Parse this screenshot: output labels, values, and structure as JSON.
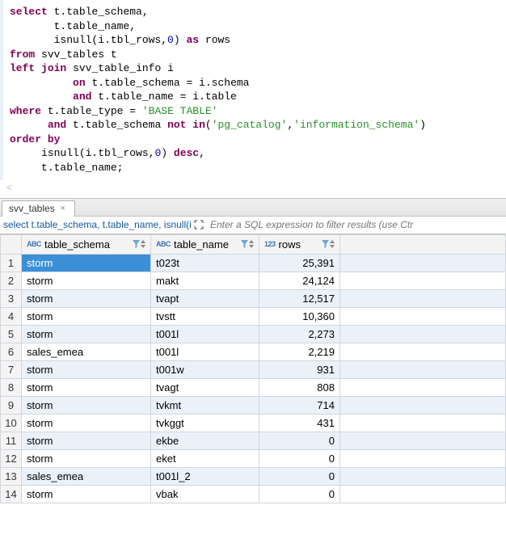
{
  "sql": {
    "t1": "select",
    "t2": "t.table_schema,",
    "t3": "t.table_name,",
    "t4a": "isnull",
    "t4b": "(i.tbl_rows,",
    "t4num": "0",
    "t4c": ")",
    "t4as": "as",
    "t4d": "rows",
    "t5a": "from",
    "t5b": "svv_tables t",
    "t6a": "left",
    "t6b": "join",
    "t6c": "svv_table_info i",
    "t7a": "on",
    "t7b": "t.table_schema = i.schema",
    "t8a": "and",
    "t8b": "t.table_name = i.table",
    "t9a": "where",
    "t9b": "t.table_type =",
    "t9str": "'BASE TABLE'",
    "t10a": "and",
    "t10b": "t.table_schema",
    "t10c": "not",
    "t10d": "in",
    "t10e": "(",
    "t10s1": "'pg_catalog'",
    "t10f": ",",
    "t10s2": "'information_schema'",
    "t10g": ")",
    "t11a": "order",
    "t11b": "by",
    "t12a": "isnull",
    "t12b": "(i.tbl_rows,",
    "t12num": "0",
    "t12c": ")",
    "t12d": "desc",
    "t12e": ",",
    "t13": "t.table_name;"
  },
  "scroll_hint": "<",
  "tab": {
    "label": "svv_tables",
    "close": "×"
  },
  "filter": {
    "echo": "select t.table_schema, t.table_name, isnull(i.tbl",
    "placeholder": "Enter a SQL expression to filter results (use Ctr"
  },
  "columns": {
    "schema": {
      "label": "table_schema",
      "type": "ABC"
    },
    "name": {
      "label": "table_name",
      "type": "ABC"
    },
    "rows": {
      "label": "rows",
      "type": "123"
    }
  },
  "chart_data": {
    "type": "table",
    "columns": [
      "table_schema",
      "table_name",
      "rows"
    ],
    "rows": [
      [
        "storm",
        "t023t",
        25391
      ],
      [
        "storm",
        "makt",
        24124
      ],
      [
        "storm",
        "tvapt",
        12517
      ],
      [
        "storm",
        "tvstt",
        10360
      ],
      [
        "storm",
        "t001l",
        2273
      ],
      [
        "sales_emea",
        "t001l",
        2219
      ],
      [
        "storm",
        "t001w",
        931
      ],
      [
        "storm",
        "tvagt",
        808
      ],
      [
        "storm",
        "tvkmt",
        714
      ],
      [
        "storm",
        "tvkggt",
        431
      ],
      [
        "storm",
        "ekbe",
        0
      ],
      [
        "storm",
        "eket",
        0
      ],
      [
        "sales_emea",
        "t001l_2",
        0
      ],
      [
        "storm",
        "vbak",
        0
      ]
    ]
  }
}
